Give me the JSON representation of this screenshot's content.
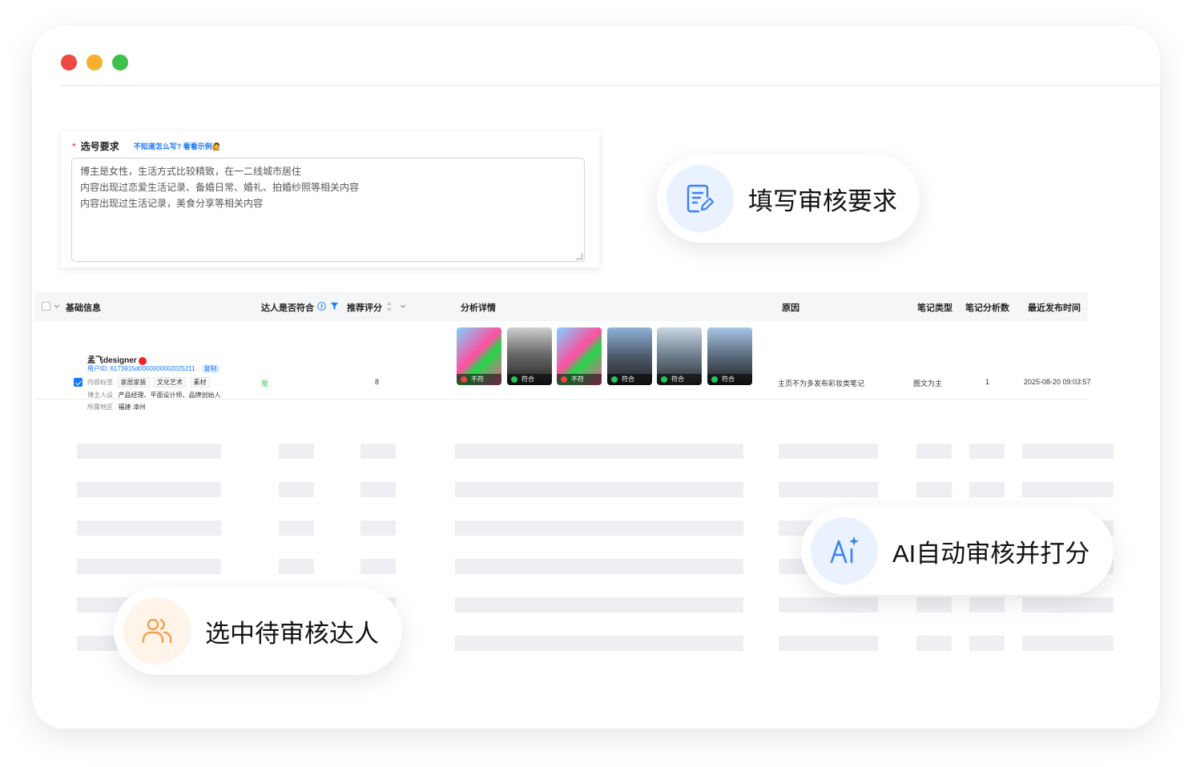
{
  "window": {
    "dot_colors": [
      "#ec4a42",
      "#f5b12c",
      "#3ec14a"
    ]
  },
  "requirement": {
    "required_mark": "*",
    "title": "选号要求",
    "hint": "不知道怎么写? 看看示例🙋",
    "lines": [
      "博主是女性，生活方式比较精致，在一二线城市居住",
      "内容出现过恋爱生活记录、备婚日常、婚礼、拍婚纱照等相关内容",
      "内容出现过生活记录，美食分享等相关内容"
    ]
  },
  "table": {
    "headers": {
      "basic": "基础信息",
      "match": "达人是否符合",
      "score": "推荐评分",
      "analysis": "分析详情",
      "reason": "原因",
      "note_type": "笔记类型",
      "note_count": "笔记分析数",
      "latest": "最近发布时间"
    },
    "row": {
      "name": "孟飞designer",
      "uid": "用户ID: 6173915d0000000002025211",
      "copy": "复制",
      "tag_label": "内容标签",
      "tags": [
        "家居家装",
        "文化艺术",
        "素材"
      ],
      "persona_label": "博主人设",
      "persona": "产品经理、平面设计师、品牌创始人",
      "region_label": "所属地区",
      "region": "福建 漳州",
      "match": "是",
      "score": "8",
      "thumbs": [
        {
          "label": "不符",
          "status": "fail"
        },
        {
          "label": "符合",
          "status": "pass"
        },
        {
          "label": "不符",
          "status": "fail"
        },
        {
          "label": "符合",
          "status": "pass"
        },
        {
          "label": "符合",
          "status": "pass"
        },
        {
          "label": "符合",
          "status": "pass"
        }
      ],
      "reason": "主页不为多发布彩妆类笔记",
      "note_type": "图文为主",
      "note_count": "1",
      "latest": "2025-08-20  09:03:57"
    }
  },
  "pills": {
    "fill_requirement": "填写审核要求",
    "ai_review": "AI自动审核并打分",
    "select_talent": "选中待审核达人"
  },
  "colors": {
    "primary": "#1677ff",
    "pass": "#22c55e",
    "fail": "#ef4444",
    "match_yes": "#2fbf4a"
  }
}
